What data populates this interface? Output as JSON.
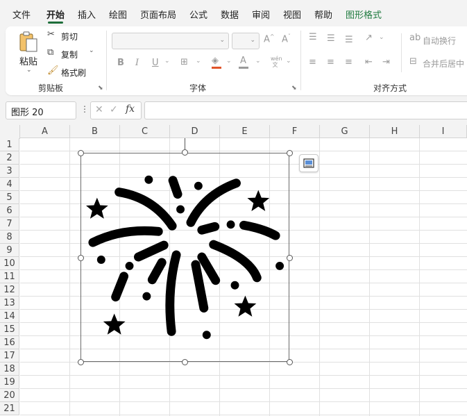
{
  "tabs": [
    "文件",
    "开始",
    "插入",
    "绘图",
    "页面布局",
    "公式",
    "数据",
    "审阅",
    "视图",
    "帮助",
    "图形格式"
  ],
  "ribbon": {
    "clipboard": {
      "paste": "粘贴",
      "cut": "剪切",
      "copy": "复制",
      "format_painter": "格式刷",
      "label": "剪贴板"
    },
    "font": {
      "label": "字体",
      "bold": "B",
      "italic": "I",
      "underline": "U"
    },
    "alignment": {
      "label": "对齐方式",
      "wrap_text": "自动换行",
      "merge_center": "合并后居中"
    }
  },
  "name_box": "图形 20",
  "formula": "",
  "columns": [
    "A",
    "B",
    "C",
    "D",
    "E",
    "F",
    "G",
    "H",
    "I"
  ],
  "rows": [
    "1",
    "2",
    "3",
    "4",
    "5",
    "6",
    "7",
    "8",
    "9",
    "10",
    "11",
    "12",
    "13",
    "14",
    "15",
    "16",
    "17",
    "18",
    "19",
    "20",
    "21"
  ],
  "shape_icon": "fireworks-icon",
  "accent": "#1e6e3a"
}
